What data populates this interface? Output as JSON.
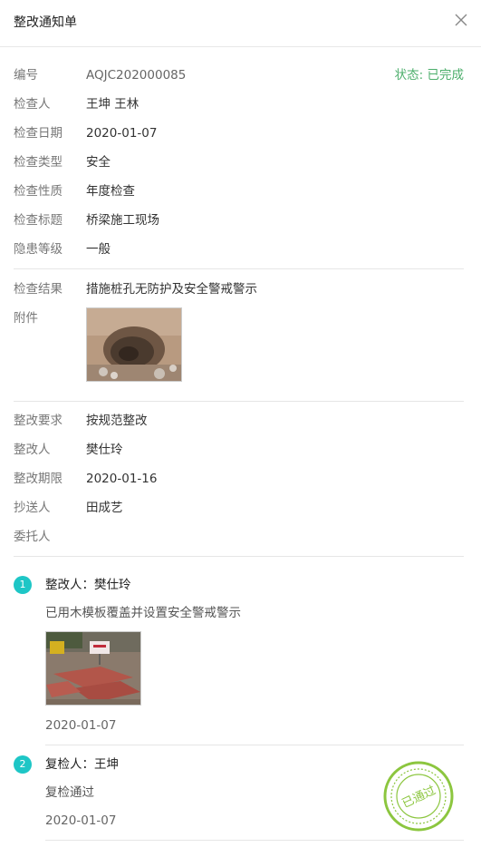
{
  "header": {
    "title": "整改通知单"
  },
  "status": "状态: 已完成",
  "inspection": [
    {
      "label": "编号",
      "value": "AQJC202000085"
    },
    {
      "label": "检查人",
      "value": "王坤 王林"
    },
    {
      "label": "检查日期",
      "value": "2020-01-07"
    },
    {
      "label": "检查类型",
      "value": "安全"
    },
    {
      "label": "检查性质",
      "value": "年度检查"
    },
    {
      "label": "检查标题",
      "value": "桥梁施工现场"
    },
    {
      "label": "隐患等级",
      "value": "一般"
    }
  ],
  "result": {
    "label": "检查结果",
    "value": "措施桩孔无防护及安全警戒警示"
  },
  "attachment": {
    "label": "附件"
  },
  "rectify": [
    {
      "label": "整改要求",
      "value": "按规范整改"
    },
    {
      "label": "整改人",
      "value": "樊仕玲"
    },
    {
      "label": "整改期限",
      "value": "2020-01-16"
    },
    {
      "label": "抄送人",
      "value": "田成艺"
    },
    {
      "label": "委托人",
      "value": ""
    }
  ],
  "steps": [
    {
      "number": "1",
      "title": "整改人：樊仕玲",
      "description": "已用木模板覆盖并设置安全警戒警示",
      "date": "2020-01-07"
    },
    {
      "number": "2",
      "title": "复检人：王坤",
      "description": "复检通过",
      "date": "2020-01-07"
    }
  ],
  "stamp": {
    "text": "已通过",
    "color": "#8cc63f"
  },
  "colors": {
    "accent": "#1ec6c6",
    "status": "#4cae6b"
  }
}
